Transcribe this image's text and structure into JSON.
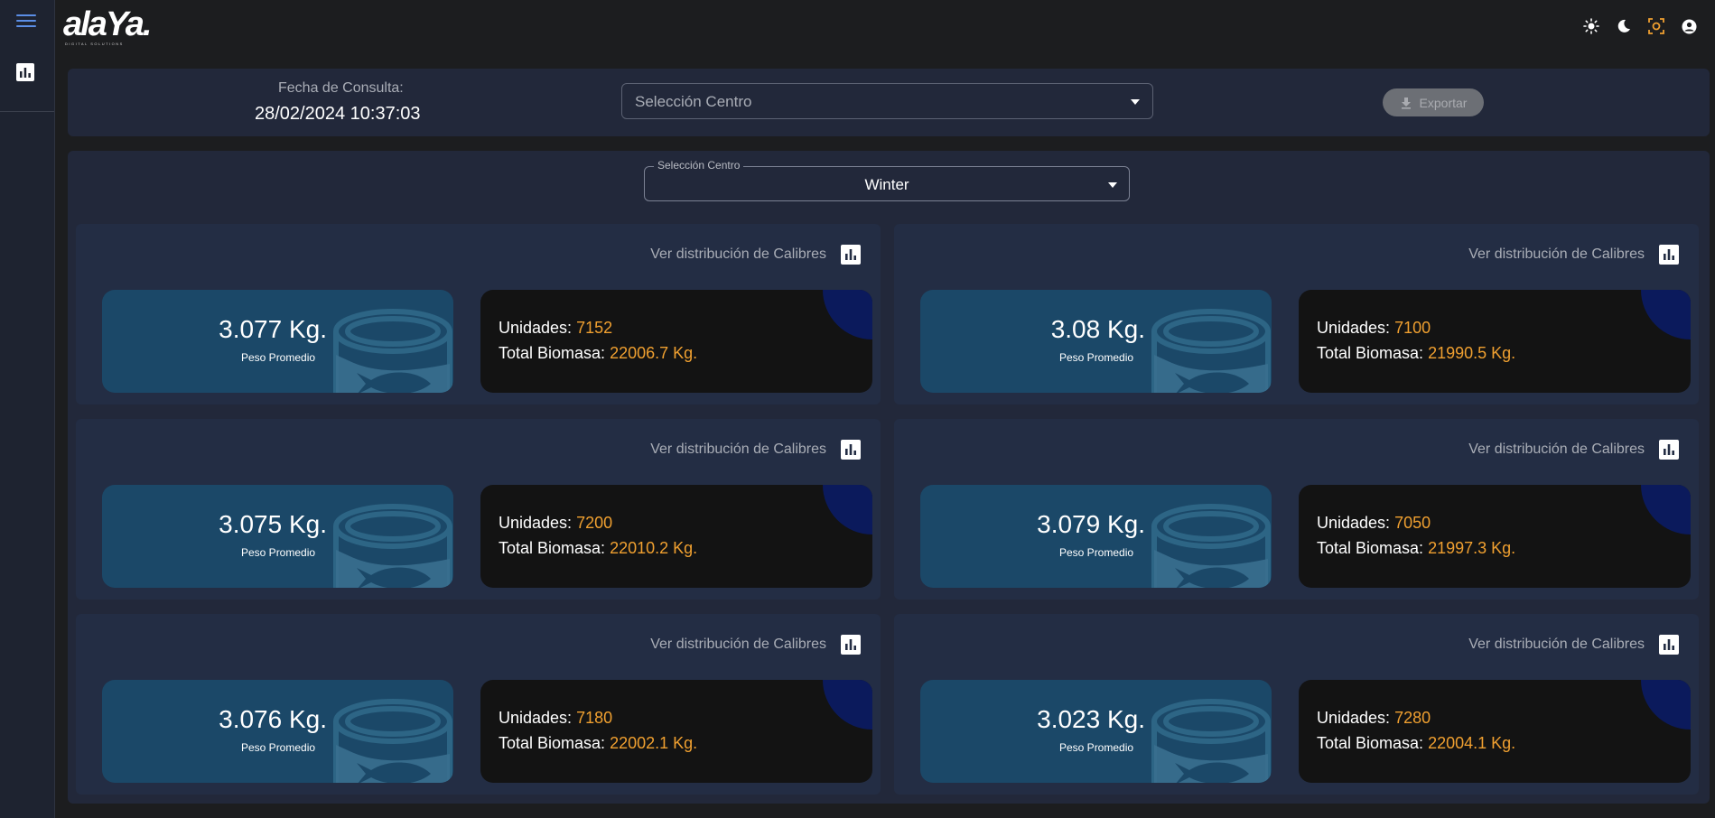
{
  "app": {
    "logo_text": "alaYa.",
    "logo_subtext": "DIGITAL SOLUTIONS"
  },
  "header": {
    "icons": [
      "sun-icon",
      "moon-icon",
      "focus-icon",
      "account-icon"
    ],
    "accent_color": "#f0a030"
  },
  "top": {
    "fecha_label": "Fecha de Consulta:",
    "fecha_value": "28/02/2024 10:37:03",
    "centro_placeholder": "Selección Centro",
    "export_label": "Exportar"
  },
  "main": {
    "select_legend": "Selección Centro",
    "select_value": "Winter"
  },
  "cards": [
    {
      "ver_label": "Ver distribución de Calibres",
      "peso": "3.077 Kg.",
      "peso_label": "Peso Promedio",
      "unidades_label": "Unidades:",
      "unidades": "7152",
      "biomasa_label": "Total Biomasa:",
      "biomasa": "22006.7 Kg."
    },
    {
      "ver_label": "Ver distribución de Calibres",
      "peso": "3.08 Kg.",
      "peso_label": "Peso Promedio",
      "unidades_label": "Unidades:",
      "unidades": "7100",
      "biomasa_label": "Total Biomasa:",
      "biomasa": "21990.5 Kg."
    },
    {
      "ver_label": "Ver distribución de Calibres",
      "peso": "3.075 Kg.",
      "peso_label": "Peso Promedio",
      "unidades_label": "Unidades:",
      "unidades": "7200",
      "biomasa_label": "Total Biomasa:",
      "biomasa": "22010.2 Kg."
    },
    {
      "ver_label": "Ver distribución de Calibres",
      "peso": "3.079 Kg.",
      "peso_label": "Peso Promedio",
      "unidades_label": "Unidades:",
      "unidades": "7050",
      "biomasa_label": "Total Biomasa:",
      "biomasa": "21997.3 Kg."
    },
    {
      "ver_label": "Ver distribución de Calibres",
      "peso": "3.076 Kg.",
      "peso_label": "Peso Promedio",
      "unidades_label": "Unidades:",
      "unidades": "7180",
      "biomasa_label": "Total Biomasa:",
      "biomasa": "22002.1 Kg."
    },
    {
      "ver_label": "Ver distribución de Calibres",
      "peso": "3.023 Kg.",
      "peso_label": "Peso Promedio",
      "unidades_label": "Unidades:",
      "unidades": "7280",
      "biomasa_label": "Total Biomasa:",
      "biomasa": "22004.1 Kg."
    }
  ]
}
